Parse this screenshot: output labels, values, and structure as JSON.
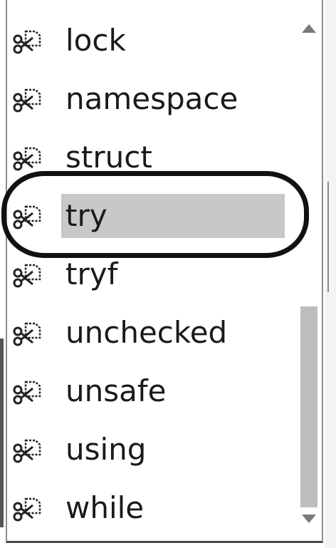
{
  "popup": {
    "items": [
      {
        "label": "lock",
        "icon": "snippet-icon",
        "selected": false
      },
      {
        "label": "namespace",
        "icon": "snippet-icon",
        "selected": false
      },
      {
        "label": "struct",
        "icon": "snippet-icon",
        "selected": false
      },
      {
        "label": "try",
        "icon": "snippet-icon",
        "selected": true
      },
      {
        "label": "tryf",
        "icon": "snippet-icon",
        "selected": false
      },
      {
        "label": "unchecked",
        "icon": "snippet-icon",
        "selected": false
      },
      {
        "label": "unsafe",
        "icon": "snippet-icon",
        "selected": false
      },
      {
        "label": "using",
        "icon": "snippet-icon",
        "selected": false
      },
      {
        "label": "while",
        "icon": "snippet-icon",
        "selected": false
      }
    ]
  },
  "scrollbar": {
    "up_icon": "triangle-up-icon",
    "down_icon": "triangle-down-icon",
    "position": 0.85
  },
  "colors": {
    "selection": "#c8c8c8",
    "annotation": "#111111",
    "thumb": "#bdbdbd"
  }
}
